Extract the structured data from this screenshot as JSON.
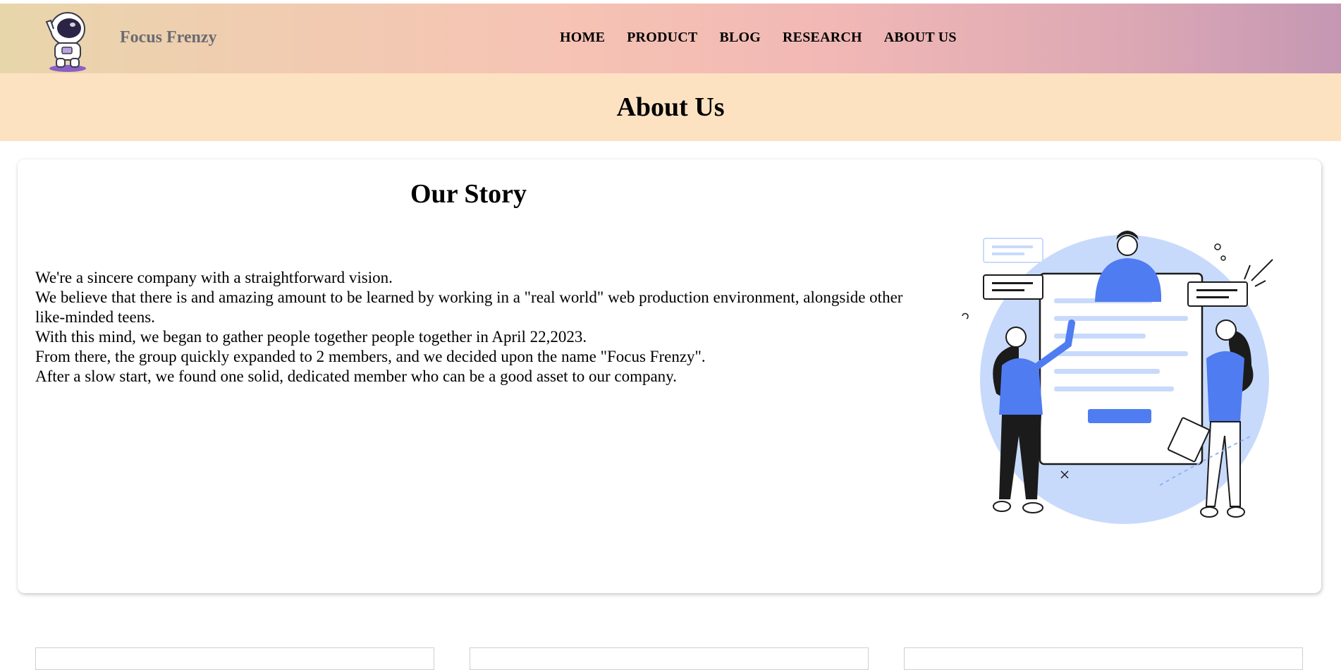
{
  "header": {
    "brand": "Focus Frenzy",
    "logo_icon": "astronaut-icon",
    "nav": [
      {
        "label": "HOME"
      },
      {
        "label": "PRODUCT"
      },
      {
        "label": "BLOG"
      },
      {
        "label": "RESEARCH"
      },
      {
        "label": "ABOUT US"
      }
    ]
  },
  "banner": {
    "title": "About Us"
  },
  "story": {
    "heading": "Our Story",
    "lines": [
      "We're a sincere company with a straightforward vision.",
      "We believe that there is and amazing amount to be learned by working in a \"real world\" web production environment, alongside other like-minded teens.",
      "With this mind, we began to gather people together people together in April 22,2023.",
      "From there, the group quickly expanded to 2 members, and we decided upon the name \"Focus Frenzy\".",
      "After a slow start, we found one solid, dedicated member who can be a good asset to our company."
    ],
    "illustration_icon": "team-collaboration-illustration"
  },
  "colors": {
    "banner_bg": "#fde2c2",
    "accent_blue": "#4f7cf0",
    "light_blue": "#c8dafb"
  }
}
